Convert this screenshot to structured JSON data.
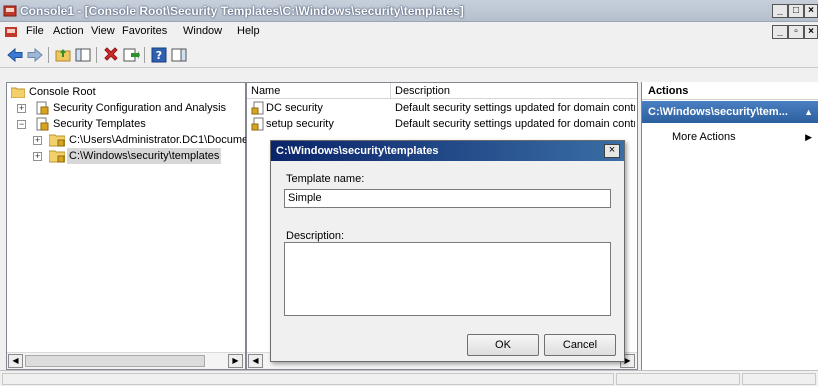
{
  "window": {
    "title": "Console1 - [Console Root\\Security Templates\\C:\\Windows\\security\\templates]",
    "min": "_",
    "max": "□",
    "close": "×"
  },
  "menu": [
    "File",
    "Action",
    "View",
    "Favorites",
    "Window",
    "Help"
  ],
  "tree": {
    "root": "Console Root",
    "items": [
      {
        "label": "Security Configuration and Analysis",
        "expander": "+"
      },
      {
        "label": "Security Templates",
        "expander": "−"
      },
      {
        "label": "C:\\Users\\Administrator.DC1\\Docume",
        "expander": "+"
      },
      {
        "label": "C:\\Windows\\security\\templates",
        "expander": "+"
      }
    ]
  },
  "list": {
    "columns": [
      "Name",
      "Description"
    ],
    "rows": [
      {
        "name": "DC security",
        "description": "Default security settings updated for domain controll"
      },
      {
        "name": "setup security",
        "description": "Default security settings updated for domain controll"
      }
    ]
  },
  "actions": {
    "header": "Actions",
    "section": "C:\\Windows\\security\\tem...",
    "more": "More Actions"
  },
  "dialog": {
    "title": "C:\\Windows\\security\\templates",
    "template_name_label": "Template name:",
    "template_name_value": "Simple",
    "description_label": "Description:",
    "description_value": "",
    "ok": "OK",
    "cancel": "Cancel"
  }
}
